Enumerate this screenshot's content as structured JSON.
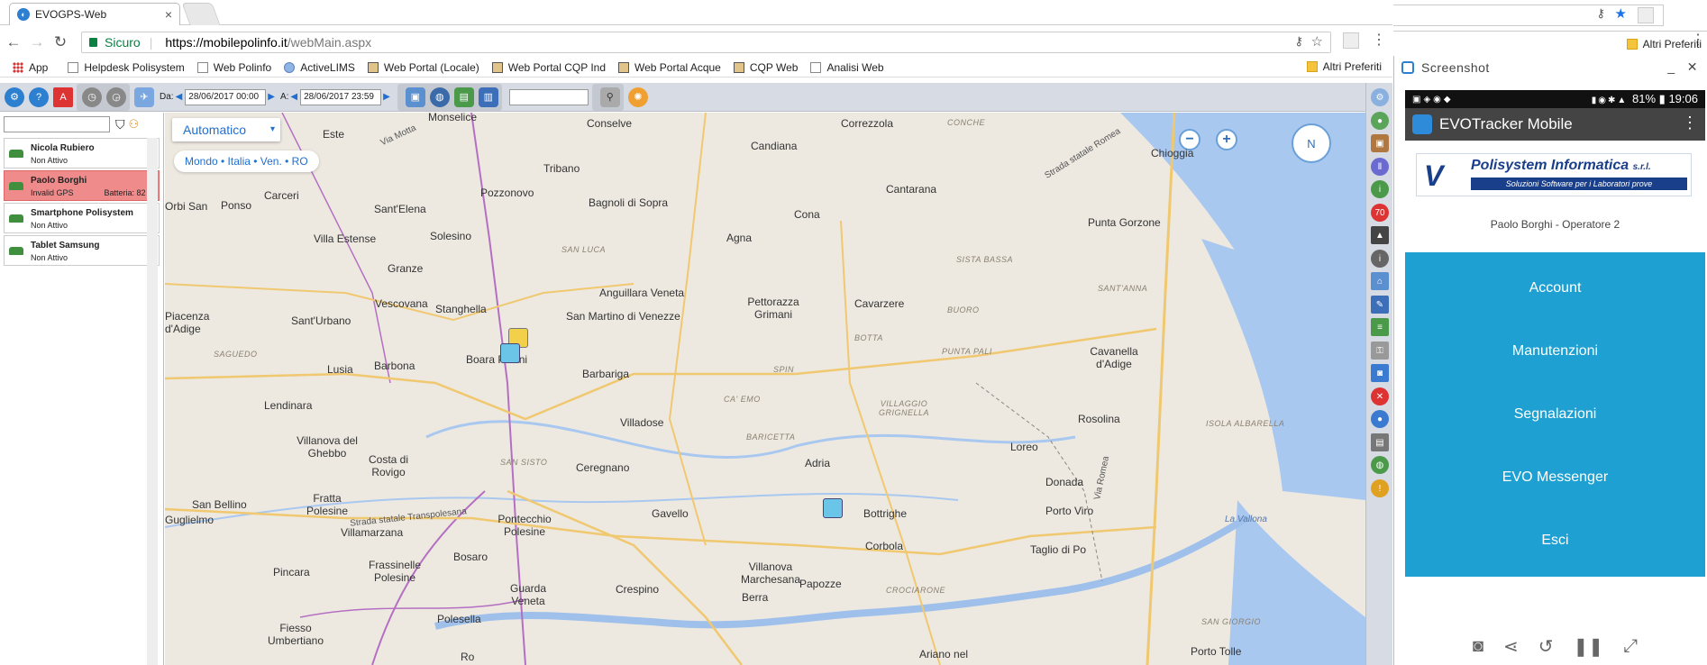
{
  "browser": {
    "tab_title": "EVOGPS-Web",
    "secure_label": "Sicuro",
    "url_scheme_host": "https://mobilepolinfo.it",
    "url_path": "/webMain.aspx",
    "bookmarks": [
      "App",
      "Helpdesk Polisystem",
      "Web Polinfo",
      "ActiveLIMS",
      "Web Portal (Locale)",
      "Web Portal CQP Ind",
      "Web Portal Acque",
      "CQP Web",
      "Analisi Web"
    ],
    "other_bookmarks": "Altri Preferiti"
  },
  "toolbar": {
    "from_label": "Da:",
    "from_value": "28/06/2017 00:00",
    "to_label": "A:",
    "to_value": "28/06/2017 23:59"
  },
  "vehicles": [
    {
      "name": "Nicola Rubiero",
      "status": "Non Attivo",
      "battery": ""
    },
    {
      "name": "Paolo Borghi",
      "status": "Invalid GPS",
      "battery": "Batteria: 82 %"
    },
    {
      "name": "Smartphone Polisystem",
      "status": "Non Attivo",
      "battery": ""
    },
    {
      "name": "Tablet Samsung",
      "status": "Non Attivo",
      "battery": ""
    }
  ],
  "map": {
    "mode": "Automatico",
    "breadcrumb": "Mondo • Italia • Ven. • RO",
    "compass": "N",
    "places": [
      "Monselice",
      "Conselve",
      "Correzzola",
      "Este",
      "Candiana",
      "Chioggia",
      "Tribano",
      "Pozzonovo",
      "Bagnoli di Sopra",
      "Carceri",
      "Ponso",
      "Sant'Elena",
      "Cona",
      "Cantarana",
      "Solesino",
      "Villa Estense",
      "Agna",
      "Punta Gorzone",
      "Granze",
      "Anguillara Veneta",
      "Vescovana",
      "Stanghella",
      "Pettorazza Grimani",
      "Cavarzere",
      "San Martino di Venezze",
      "Sant'Urbano",
      "Piacenza d'Adige",
      "Boara Pisani",
      "Barbona",
      "Lusia",
      "Barbariga",
      "Cavanella d'Adige",
      "Lendinara",
      "Villadose",
      "Rosolina",
      "Villanova del Ghebbo",
      "Costa di Rovigo",
      "Ceregnano",
      "Adria",
      "Loreo",
      "Donada",
      "San Bellino",
      "Fratta Polesine",
      "Porto Viro",
      "Villamarzana",
      "Pontecchio Polesine",
      "Gavello",
      "Bottrighe",
      "Guglielmo",
      "Corbola",
      "Taglio di Po",
      "Pincara",
      "Frassinelle Polesine",
      "Bosaro",
      "Villanova Marchesana",
      "Papozze",
      "Guarda Veneta",
      "Crespino",
      "Berra",
      "Fiesso Umbertiano",
      "Polesella",
      "Porto Tolle",
      "Ariano nel",
      "Ro",
      "Orbi San",
      "Rosolina",
      "Papozze"
    ],
    "areas": [
      "SAN LUCA",
      "SISTA BASSA",
      "SANT'ANNA",
      "BUORO",
      "BOTTA",
      "PUNTA PALI",
      "SPIN",
      "CA' EMO",
      "VILLAGGIO GRIGNELLA",
      "BARICETTA",
      "SAGUEDO",
      "SAN SISTO",
      "ISOLA ALBARELLA",
      "La Vallona",
      "CROCIARONE",
      "SAN GIORGIO",
      "CONCHE"
    ],
    "roads": [
      "Strada statale Romea",
      "Via Motta",
      "Strada statale Transpolesana",
      "Via Romea"
    ]
  },
  "phone": {
    "window_title": "Screenshot",
    "battery": "81%",
    "clock": "19:06",
    "app_title": "EVOTracker Mobile",
    "logo_name": "Polisystem Informatica",
    "logo_suffix": "s.r.l.",
    "logo_tagline": "Soluzioni Software per i Laboratori prove",
    "operator": "Paolo Borghi - Operatore 2",
    "buttons": [
      "Account",
      "Manutenzioni",
      "Segnalazioni",
      "EVO Messenger",
      "Esci"
    ]
  }
}
